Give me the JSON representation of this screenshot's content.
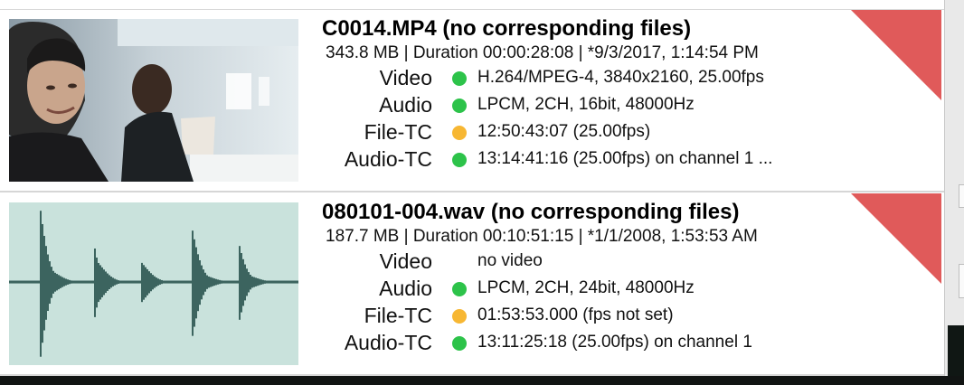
{
  "clips": [
    {
      "title": "C0014.MP4 (no corresponding files)",
      "meta": "343.8 MB | Duration 00:00:28:08 | *9/3/2017, 1:14:54 PM",
      "thumbnail": "video-frame",
      "rows": [
        {
          "label": "Video",
          "status": "green",
          "value": "H.264/MPEG-4, 3840x2160, 25.00fps"
        },
        {
          "label": "Audio",
          "status": "green",
          "value": "LPCM, 2CH, 16bit, 48000Hz"
        },
        {
          "label": "File-TC",
          "status": "orange",
          "value": "12:50:43:07 (25.00fps)"
        },
        {
          "label": "Audio-TC",
          "status": "green",
          "value": "13:14:41:16 (25.00fps) on channel 1  ..."
        }
      ]
    },
    {
      "title": "080101-004.wav (no corresponding files)",
      "meta": "187.7 MB | Duration 00:10:51:15 | *1/1/2008, 1:53:53 AM",
      "thumbnail": "audio-waveform",
      "rows": [
        {
          "label": "Video",
          "status": "none",
          "value": "no video"
        },
        {
          "label": "Audio",
          "status": "green",
          "value": "LPCM, 2CH, 24bit, 48000Hz"
        },
        {
          "label": "File-TC",
          "status": "orange",
          "value": "01:53:53.000 (fps not set)"
        },
        {
          "label": "Audio-TC",
          "status": "green",
          "value": "13:11:25:18 (25.00fps) on channel 1"
        }
      ]
    }
  ],
  "colors": {
    "status_green": "#2dc34a",
    "status_orange": "#f7b733",
    "corner_flag": "#e05a5a",
    "waveform_bg": "#c9e2dc",
    "waveform_fg": "#3c645f"
  }
}
